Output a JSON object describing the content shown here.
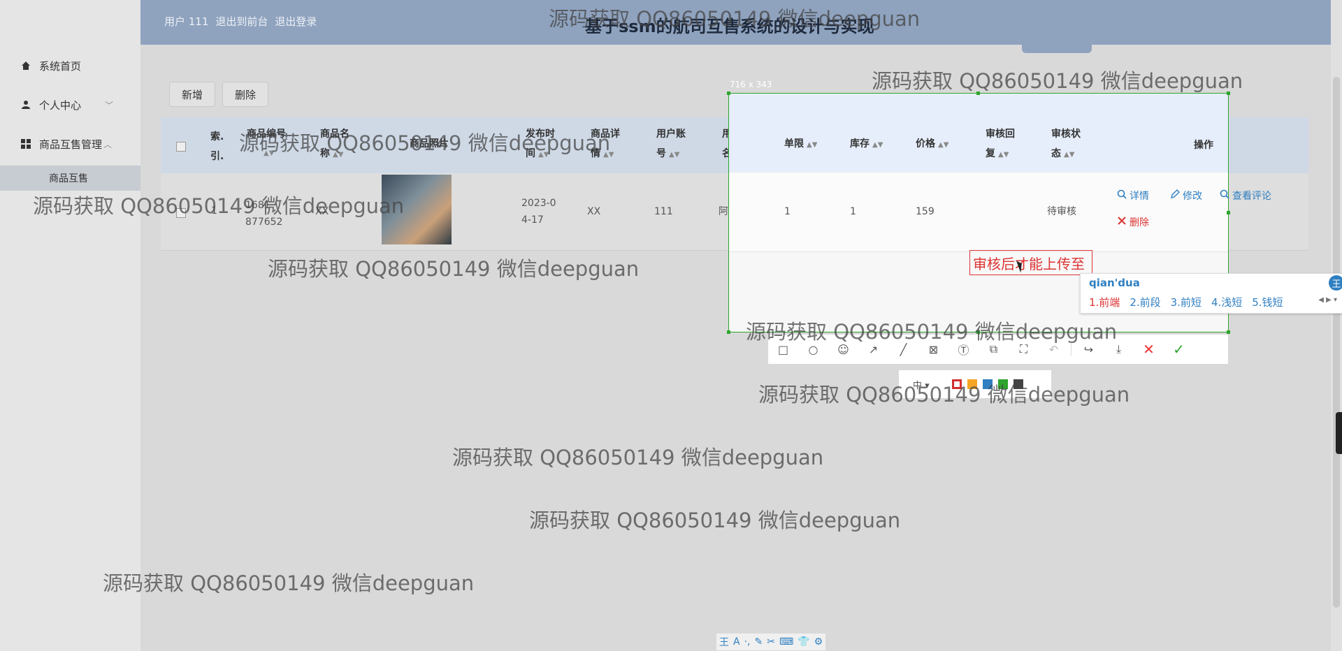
{
  "header": {
    "user_label": "用户 111",
    "back_label": "退出到前台",
    "logout_label": "退出登录",
    "title": "基于ssm的航司互售系统的设计与实现"
  },
  "sidebar": {
    "items": [
      {
        "label": "系统首页",
        "icon": "home-icon"
      },
      {
        "label": "个人中心",
        "icon": "user-icon"
      },
      {
        "label": "商品互售管理",
        "icon": "grid-icon"
      }
    ],
    "sub_item": "商品互售"
  },
  "toolbar": {
    "add_label": "新增",
    "delete_label": "删除"
  },
  "table": {
    "headers": [
      "索引",
      "商品编号",
      "商品名称",
      "商品照片",
      "发布时间",
      "商品详情",
      "用户账号",
      "用户姓名",
      "单限",
      "库存",
      "价格",
      "审核回复",
      "审核状态",
      "操作"
    ],
    "header_lines": {
      "index": [
        "索.",
        "引."
      ],
      "code": [
        "商品编号"
      ],
      "name": [
        "商品名",
        "称"
      ],
      "photo": [
        "商品照片"
      ],
      "time": [
        "发布时",
        "间"
      ],
      "detail": [
        "商品详",
        "情"
      ],
      "account": [
        "用户账",
        "号"
      ],
      "username": [
        "用户姓",
        "名"
      ],
      "limit": [
        "单限"
      ],
      "stock": [
        "库存"
      ],
      "price": [
        "价格"
      ],
      "reply": [
        "审核回",
        "复"
      ],
      "status": [
        "审核状",
        "态"
      ],
      "ops": [
        "操作"
      ]
    },
    "row": {
      "index": "1",
      "code_l1": "1681",
      "code_l2": "877652",
      "name": "XX",
      "time_l1": "2023-0",
      "time_l2": "4-17",
      "detail": "XX",
      "account": "111",
      "username": "阿丫",
      "limit": "1",
      "stock": "1",
      "price": "159",
      "reply": "",
      "status": "待审核"
    },
    "actions": {
      "detail": "详情",
      "edit": "修改",
      "comments": "查看评论",
      "delete": "删除"
    }
  },
  "capture": {
    "size_label": "716 x 343",
    "text_annotation": "审核后才能上传至"
  },
  "ime": {
    "pinyin": "qian'dua",
    "candidates": [
      "1.前端",
      "2.前段",
      "3.前短",
      "4.浅短",
      "5.钱短"
    ],
    "logo": "王"
  },
  "palette": {
    "size_label": "中",
    "colors": [
      "#d32f2f",
      "#f5a623",
      "#2f7fc1",
      "#2ea52e",
      "#444444"
    ]
  },
  "imebar": {
    "items": [
      "王",
      "A",
      "·,",
      "✎",
      "✂",
      "⌨",
      "👕",
      "⚙"
    ]
  },
  "watermark": "源码获取 QQ86050149 微信deepguan"
}
